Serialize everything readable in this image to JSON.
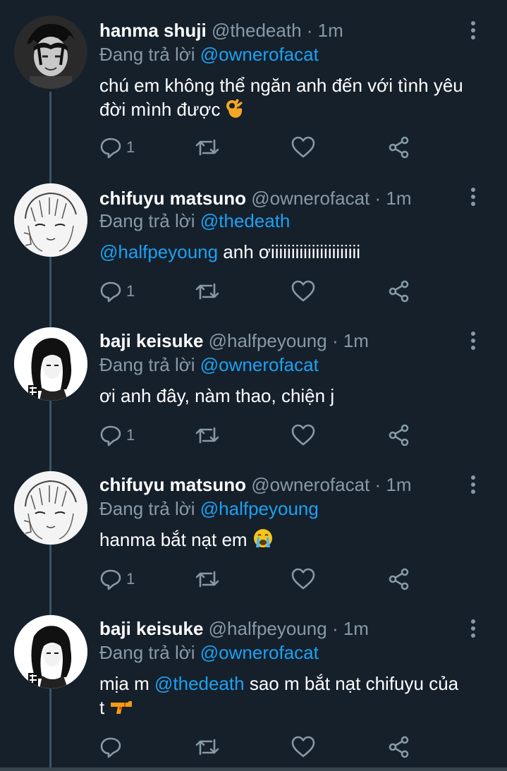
{
  "colors": {
    "background": "#15202b",
    "secondary_text": "#8899a6",
    "accent": "#1da1f2",
    "thread_line": "#3d5466"
  },
  "icons": [
    "more-vertical-icon",
    "reply-icon",
    "retweet-icon",
    "like-icon",
    "share-icon"
  ],
  "tweets": [
    {
      "name": "hanma shuji",
      "handle": "@thedeath",
      "sep": " · ",
      "time": "1m",
      "replying_prefix": "Đang trả lời ",
      "replying_to": "@ownerofacat",
      "body_text": "chú em không thể ngăn anh đến với tình yêu đời mình được",
      "body_emoji": "ok-hand",
      "reply_count": "1"
    },
    {
      "name": "chifuyu matsuno",
      "handle": "@ownerofacat",
      "sep": " · ",
      "time": "1m",
      "replying_prefix": "Đang trả lời ",
      "replying_to": "@thedeath",
      "body_mention": "@halfpeyoung",
      "body_text": " anh ơiiiiiiiiiiiiiiiiiiiiii",
      "reply_count": "1"
    },
    {
      "name": "baji keisuke",
      "handle": "@halfpeyoung",
      "sep": " · ",
      "time": "1m",
      "replying_prefix": "Đang trả lời ",
      "replying_to": "@ownerofacat",
      "body_text": "ơi anh đây, nàm thao, chiện j",
      "reply_count": "1"
    },
    {
      "name": "chifuyu matsuno",
      "handle": "@ownerofacat",
      "sep": " · ",
      "time": "1m",
      "replying_prefix": "Đang trả lời ",
      "replying_to": "@halfpeyoung",
      "body_text": "hanma bắt nạt em",
      "body_emoji": "crying-face",
      "reply_count": "1"
    },
    {
      "name": "baji keisuke",
      "handle": "@halfpeyoung",
      "sep": " · ",
      "time": "1m",
      "replying_prefix": "Đang trả lời ",
      "replying_to": "@ownerofacat",
      "body_text_a": "mịa m ",
      "body_mention": "@thedeath",
      "body_text_b": " sao m bắt nạt chifuyu của t",
      "body_emoji": "water-pistol",
      "reply_count": ""
    }
  ]
}
